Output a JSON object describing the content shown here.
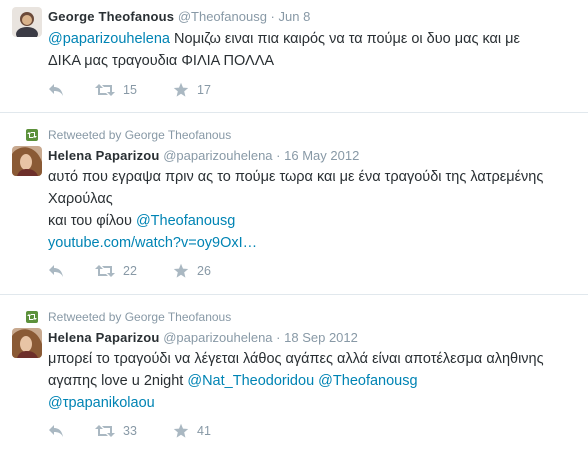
{
  "tweets": [
    {
      "name": "George Theofanous",
      "handle": "@Theofanousg",
      "dot": "·",
      "time": "Jun 8",
      "lines": [
        [
          {
            "t": "@paparizouhelena",
            "link": true
          },
          {
            "t": " Νομιζω ειναι πια καιρός να τα πούμε οι δυο μας και με",
            "link": false
          }
        ],
        [
          {
            "t": "ΔΙΚΑ μας τραγουδια ΦΙΛΙΑ ΠΟΛΛΑ",
            "link": false
          }
        ]
      ],
      "retweets": "15",
      "favorites": "17"
    },
    {
      "retweeted_by": "Retweeted by George Theofanous",
      "name": "Helena Paparizou",
      "handle": "@paparizouhelena",
      "dot": "·",
      "time": "16 May 2012",
      "lines": [
        [
          {
            "t": "αυτό που εγραψα πριν ας το πούμε τωρα  και με ένα τραγούδι της λατρεμένης",
            "link": false
          }
        ],
        [
          {
            "t": "Χαρούλας",
            "link": false
          }
        ],
        [
          {
            "t": "και του φίλου ",
            "link": false
          },
          {
            "t": "@Theofanousg",
            "link": true
          }
        ],
        [
          {
            "t": "youtube.com/watch?v=oy9OxI…",
            "link": true
          }
        ]
      ],
      "retweets": "22",
      "favorites": "26"
    },
    {
      "retweeted_by": "Retweeted by George Theofanous",
      "name": "Helena Paparizou",
      "handle": "@paparizouhelena",
      "dot": "·",
      "time": "18 Sep 2012",
      "lines": [
        [
          {
            "t": "μπορεί το τραγούδι να λέγεται λάθος αγάπες αλλά είναι αποτέλεσμα αληθινης",
            "link": false
          }
        ],
        [
          {
            "t": "αγαπης love u 2night ",
            "link": false
          },
          {
            "t": "@Nat_Theodoridou",
            "link": true
          },
          {
            "t": " ",
            "link": false
          },
          {
            "t": "@Theofanousg",
            "link": true
          }
        ],
        [
          {
            "t": "@τpapanikolaou",
            "link": true
          }
        ]
      ],
      "retweets": "33",
      "favorites": "41"
    }
  ],
  "colors": {
    "link": "#0084b4",
    "muted": "#8899a6",
    "icon": "#aab8c2",
    "retweet_green": "#5c913b",
    "divider": "#e1e8ed"
  }
}
